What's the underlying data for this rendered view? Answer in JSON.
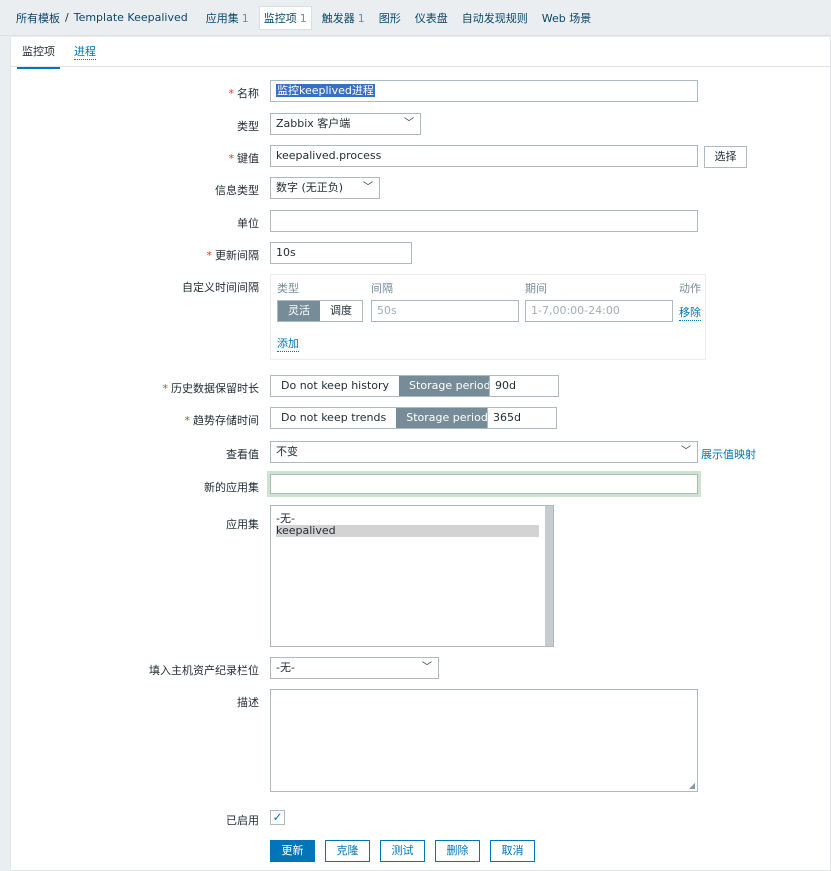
{
  "breadcrumb": {
    "all_templates": "所有模板",
    "separator": "/",
    "template": "Template Keepalived",
    "tabs": [
      {
        "label": "应用集",
        "count": "1"
      },
      {
        "label": "监控项",
        "count": "1"
      },
      {
        "label": "触发器",
        "count": "1"
      },
      {
        "label": "图形",
        "count": ""
      },
      {
        "label": "仪表盘",
        "count": ""
      },
      {
        "label": "自动发现规则",
        "count": ""
      },
      {
        "label": "Web 场景",
        "count": ""
      }
    ]
  },
  "subtabs": {
    "item": "监控项",
    "process": "进程"
  },
  "form": {
    "name": {
      "label": "名称",
      "value": "监控keeplived进程"
    },
    "type": {
      "label": "类型",
      "value": "Zabbix 客户端"
    },
    "key": {
      "label": "键值",
      "value": "keepalived.process",
      "select_button": "选择"
    },
    "info_type": {
      "label": "信息类型",
      "value": "数字 (无正负)"
    },
    "units": {
      "label": "单位",
      "value": ""
    },
    "update_interval": {
      "label": "更新间隔",
      "value": "10s"
    },
    "custom_intervals": {
      "label": "自定义时间间隔",
      "headers": {
        "type": "类型",
        "interval": "间隔",
        "period": "期间",
        "action": "动作"
      },
      "row": {
        "flexible": "灵活",
        "scheduling": "调度",
        "interval_placeholder": "50s",
        "period_placeholder": "1-7,00:00-24:00",
        "remove": "移除"
      },
      "add": "添加"
    },
    "history": {
      "label": "历史数据保留时长",
      "option_off": "Do not keep history",
      "option_on": "Storage period",
      "value": "90d"
    },
    "trends": {
      "label": "趋势存储时间",
      "option_off": "Do not keep trends",
      "option_on": "Storage period",
      "value": "365d"
    },
    "show_value": {
      "label": "查看值",
      "value": "不变",
      "mapping_link": "展示值映射"
    },
    "new_application": {
      "label": "新的应用集",
      "value": ""
    },
    "applications": {
      "label": "应用集",
      "options": [
        "-无-",
        "keepalived"
      ],
      "selected": "keepalived"
    },
    "inventory": {
      "label": "填入主机资产纪录栏位",
      "value": "-无-"
    },
    "description": {
      "label": "描述",
      "value": ""
    },
    "enabled": {
      "label": "已启用",
      "checked": true
    }
  },
  "buttons": {
    "update": "更新",
    "clone": "克隆",
    "test": "测试",
    "delete": "删除",
    "cancel": "取消"
  }
}
